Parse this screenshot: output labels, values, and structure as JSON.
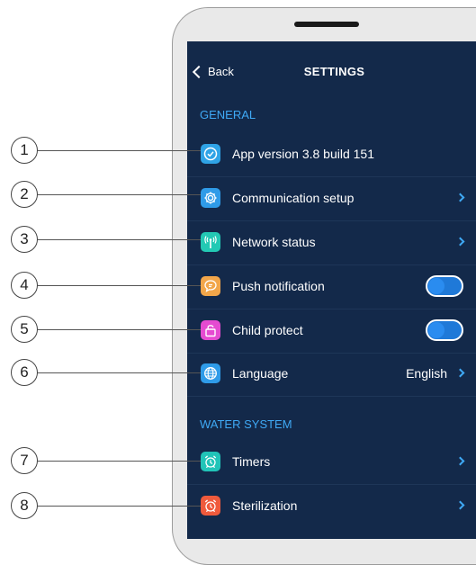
{
  "nav": {
    "back_label": "Back",
    "title": "SETTINGS"
  },
  "sections": {
    "general": "GENERAL",
    "water_system": "WATER SYSTEM"
  },
  "rows": [
    {
      "label": "App version 3.8 build 151",
      "icon": "checkmark-circle-icon",
      "icon_color": "#2fa3e6"
    },
    {
      "label": "Communication setup",
      "icon": "gear-icon",
      "icon_color": "#2f9be8"
    },
    {
      "label": "Network status",
      "icon": "antenna-icon",
      "icon_color": "#23c9b4"
    },
    {
      "label": "Push notification",
      "icon": "chat-bubble-icon",
      "icon_color": "#f2a64a",
      "toggle": true
    },
    {
      "label": "Child protect",
      "icon": "padlock-icon",
      "icon_color": "#e54bd1",
      "toggle": true
    },
    {
      "label": "Language",
      "icon": "globe-icon",
      "icon_color": "#2f9be8",
      "value": "English"
    },
    {
      "label": "Timers",
      "icon": "alarm-clock-icon",
      "icon_color": "#21c4b8"
    },
    {
      "label": "Sterilization",
      "icon": "alarm-clock-icon",
      "icon_color": "#ef5a3c"
    }
  ],
  "callouts": [
    "1",
    "2",
    "3",
    "4",
    "5",
    "6",
    "7",
    "8"
  ],
  "colors": {
    "screen_bg": "#13294a",
    "accent": "#3fa9f5",
    "toggle": "#1f79d8"
  }
}
